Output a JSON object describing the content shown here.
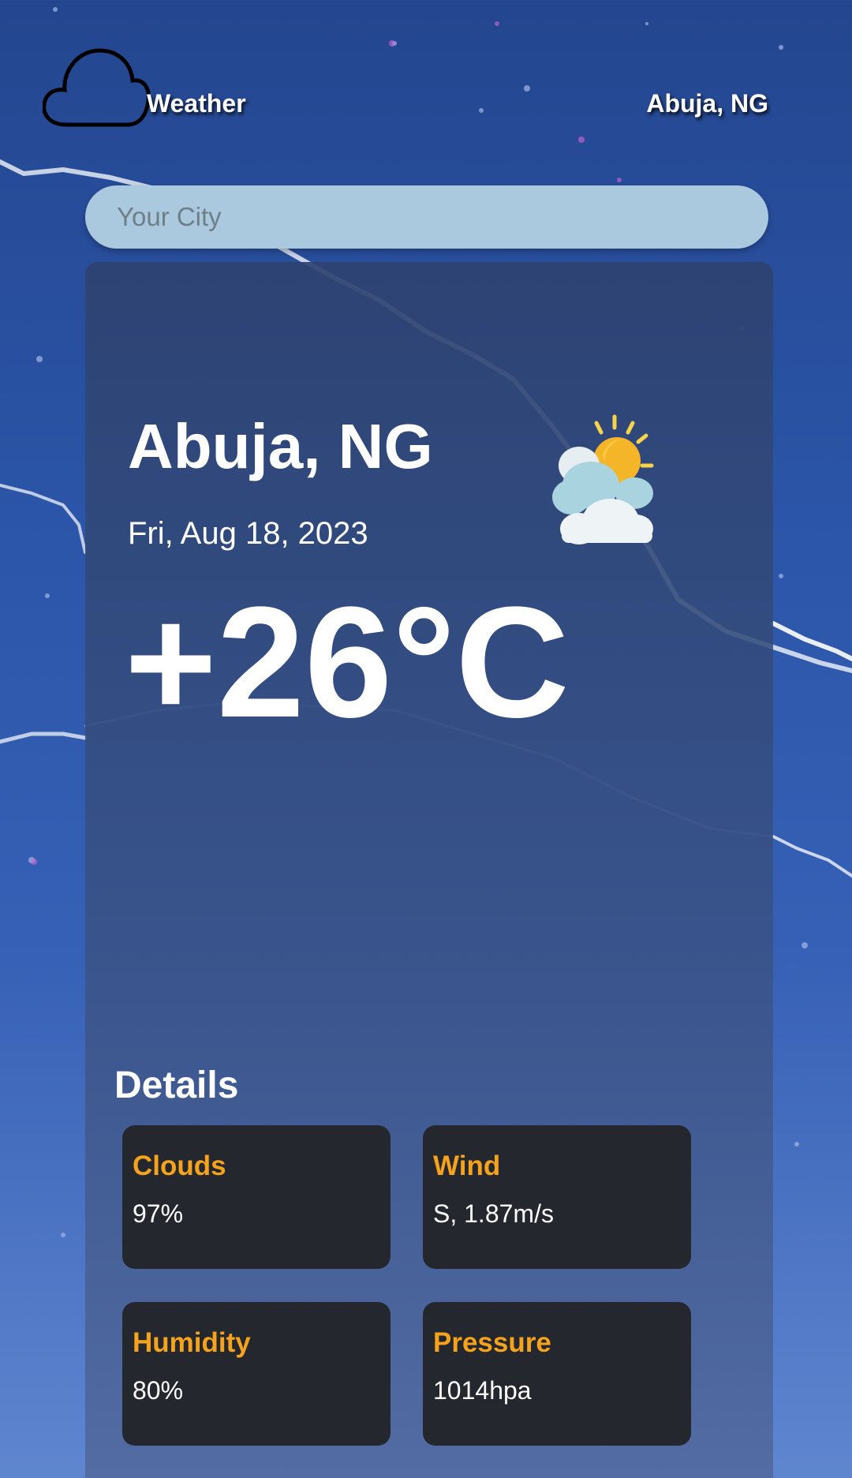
{
  "header": {
    "app_title": "Weather",
    "location": "Abuja, NG",
    "logo_icon": "cloud-outline-icon"
  },
  "search": {
    "placeholder": "Your City",
    "value": ""
  },
  "current": {
    "city": "Abuja, NG",
    "date": "Fri, Aug 18, 2023",
    "temperature": "+26°C",
    "icon": "partly-cloudy-sun-icon"
  },
  "details": {
    "title": "Details",
    "items": [
      {
        "label": "Clouds",
        "value": "97%"
      },
      {
        "label": "Wind",
        "value": "S, 1.87m/s"
      },
      {
        "label": "Humidity",
        "value": "80%"
      },
      {
        "label": "Pressure",
        "value": "1014hpa"
      }
    ]
  },
  "colors": {
    "accent": "#f5a31c",
    "tile_bg": "#25272e",
    "search_bg": "#aac9de",
    "background_top": "#24468f",
    "background_bottom": "#5f86cf"
  }
}
